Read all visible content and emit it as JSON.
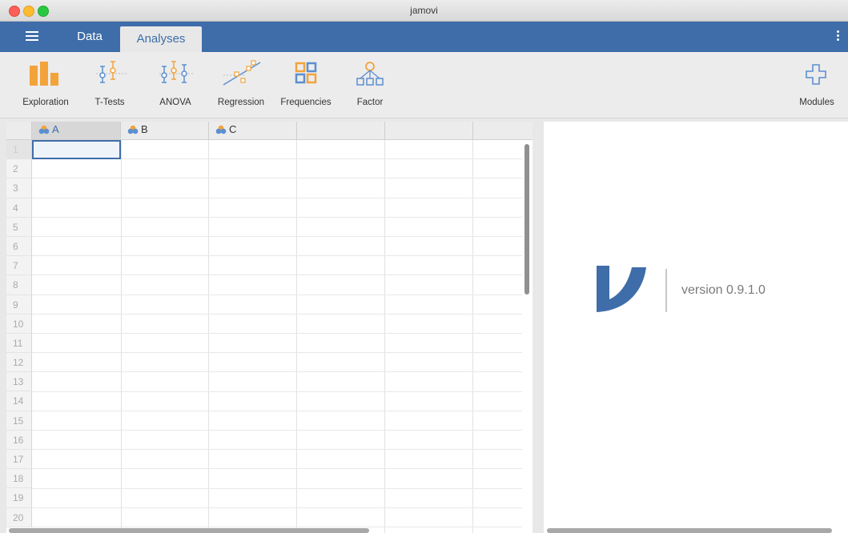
{
  "window": {
    "title": "jamovi"
  },
  "tabs": [
    {
      "label": "Data"
    },
    {
      "label": "Analyses"
    }
  ],
  "ribbon": {
    "items": [
      {
        "label": "Exploration",
        "icon": "exploration-icon"
      },
      {
        "label": "T-Tests",
        "icon": "ttest-icon"
      },
      {
        "label": "ANOVA",
        "icon": "anova-icon"
      },
      {
        "label": "Regression",
        "icon": "regression-icon"
      },
      {
        "label": "Frequencies",
        "icon": "frequencies-icon"
      },
      {
        "label": "Factor",
        "icon": "factor-icon"
      }
    ],
    "modules": {
      "label": "Modules",
      "icon": "plus-icon"
    }
  },
  "spreadsheet": {
    "columns": [
      {
        "name": "A"
      },
      {
        "name": "B"
      },
      {
        "name": "C"
      }
    ],
    "rows": [
      "1",
      "2",
      "3",
      "4",
      "5",
      "6",
      "7",
      "8",
      "9",
      "10",
      "11",
      "12",
      "13",
      "14",
      "15",
      "16",
      "17",
      "18",
      "19",
      "20"
    ]
  },
  "results": {
    "version": "version 0.9.1.0"
  },
  "colors": {
    "accent": "#3e6da9",
    "ribbon_orange": "#f3a33a",
    "ribbon_blue": "#5b8fd0"
  }
}
